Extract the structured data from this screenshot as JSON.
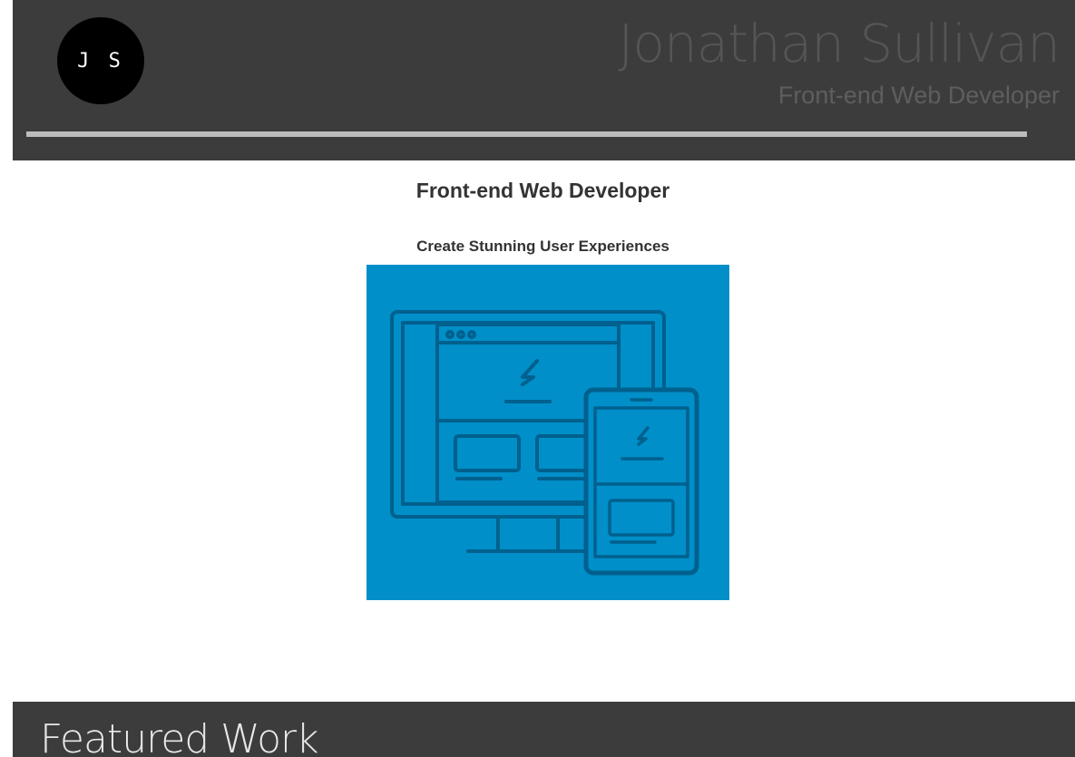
{
  "header": {
    "logo_initials": "J S",
    "name": "Jonathan Sullivan",
    "role": "Front-end Web Developer"
  },
  "main": {
    "title": "Front-end Web Developer",
    "tagline": "Create Stunning User Experiences",
    "hero_image": {
      "icon": "responsive-devices-illustration",
      "background_color": "#008fc8",
      "line_color": "#00608e"
    }
  },
  "footer": {
    "section_title": "Featured Work"
  },
  "colors": {
    "header_bg": "#3c3c3c",
    "divider": "#bdbdbd",
    "page_bg": "#ffffff"
  }
}
